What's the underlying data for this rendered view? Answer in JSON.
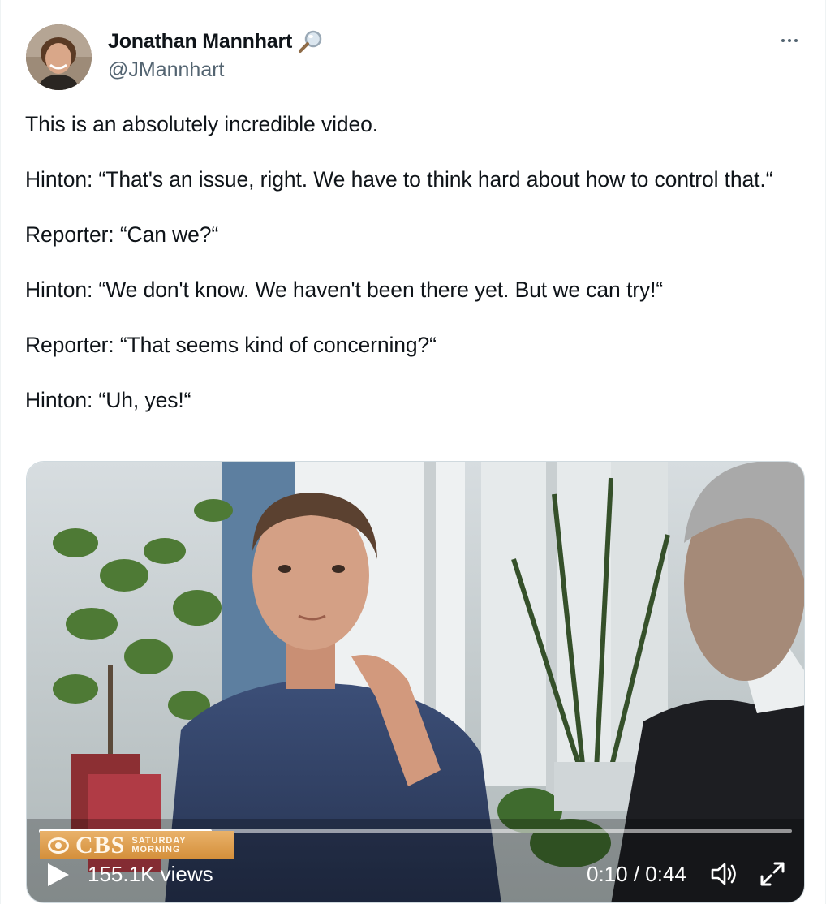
{
  "author": {
    "display_name": "Jonathan Mannhart",
    "handle": "@JMannhart",
    "badge_icon": "magnifying-glass-icon",
    "avatar_icon": "profile-photo"
  },
  "tweet": {
    "paragraphs": [
      "This is an absolutely incredible video.",
      "Hinton: “That's an issue, right. We have to think hard about how to control that.“",
      "Reporter: “Can we?“",
      "Hinton: “We don't know. We haven't been there yet. But we can try!“",
      "Reporter: “That seems kind of concerning?“",
      "Hinton: “Uh, yes!“"
    ]
  },
  "video": {
    "views": "155.1K views",
    "time": "0:10 / 0:44",
    "progress_fraction": 0.23,
    "broadcaster_logo_word": "CBS",
    "broadcaster_logo_sub1": "SATURDAY",
    "broadcaster_logo_sub2": "MORNING",
    "icons": [
      "play-icon",
      "volume-icon",
      "fullscreen-icon"
    ]
  },
  "colors": {
    "text": "#0f1419",
    "secondary": "#536471",
    "logo_orange": "#d48f3a"
  }
}
